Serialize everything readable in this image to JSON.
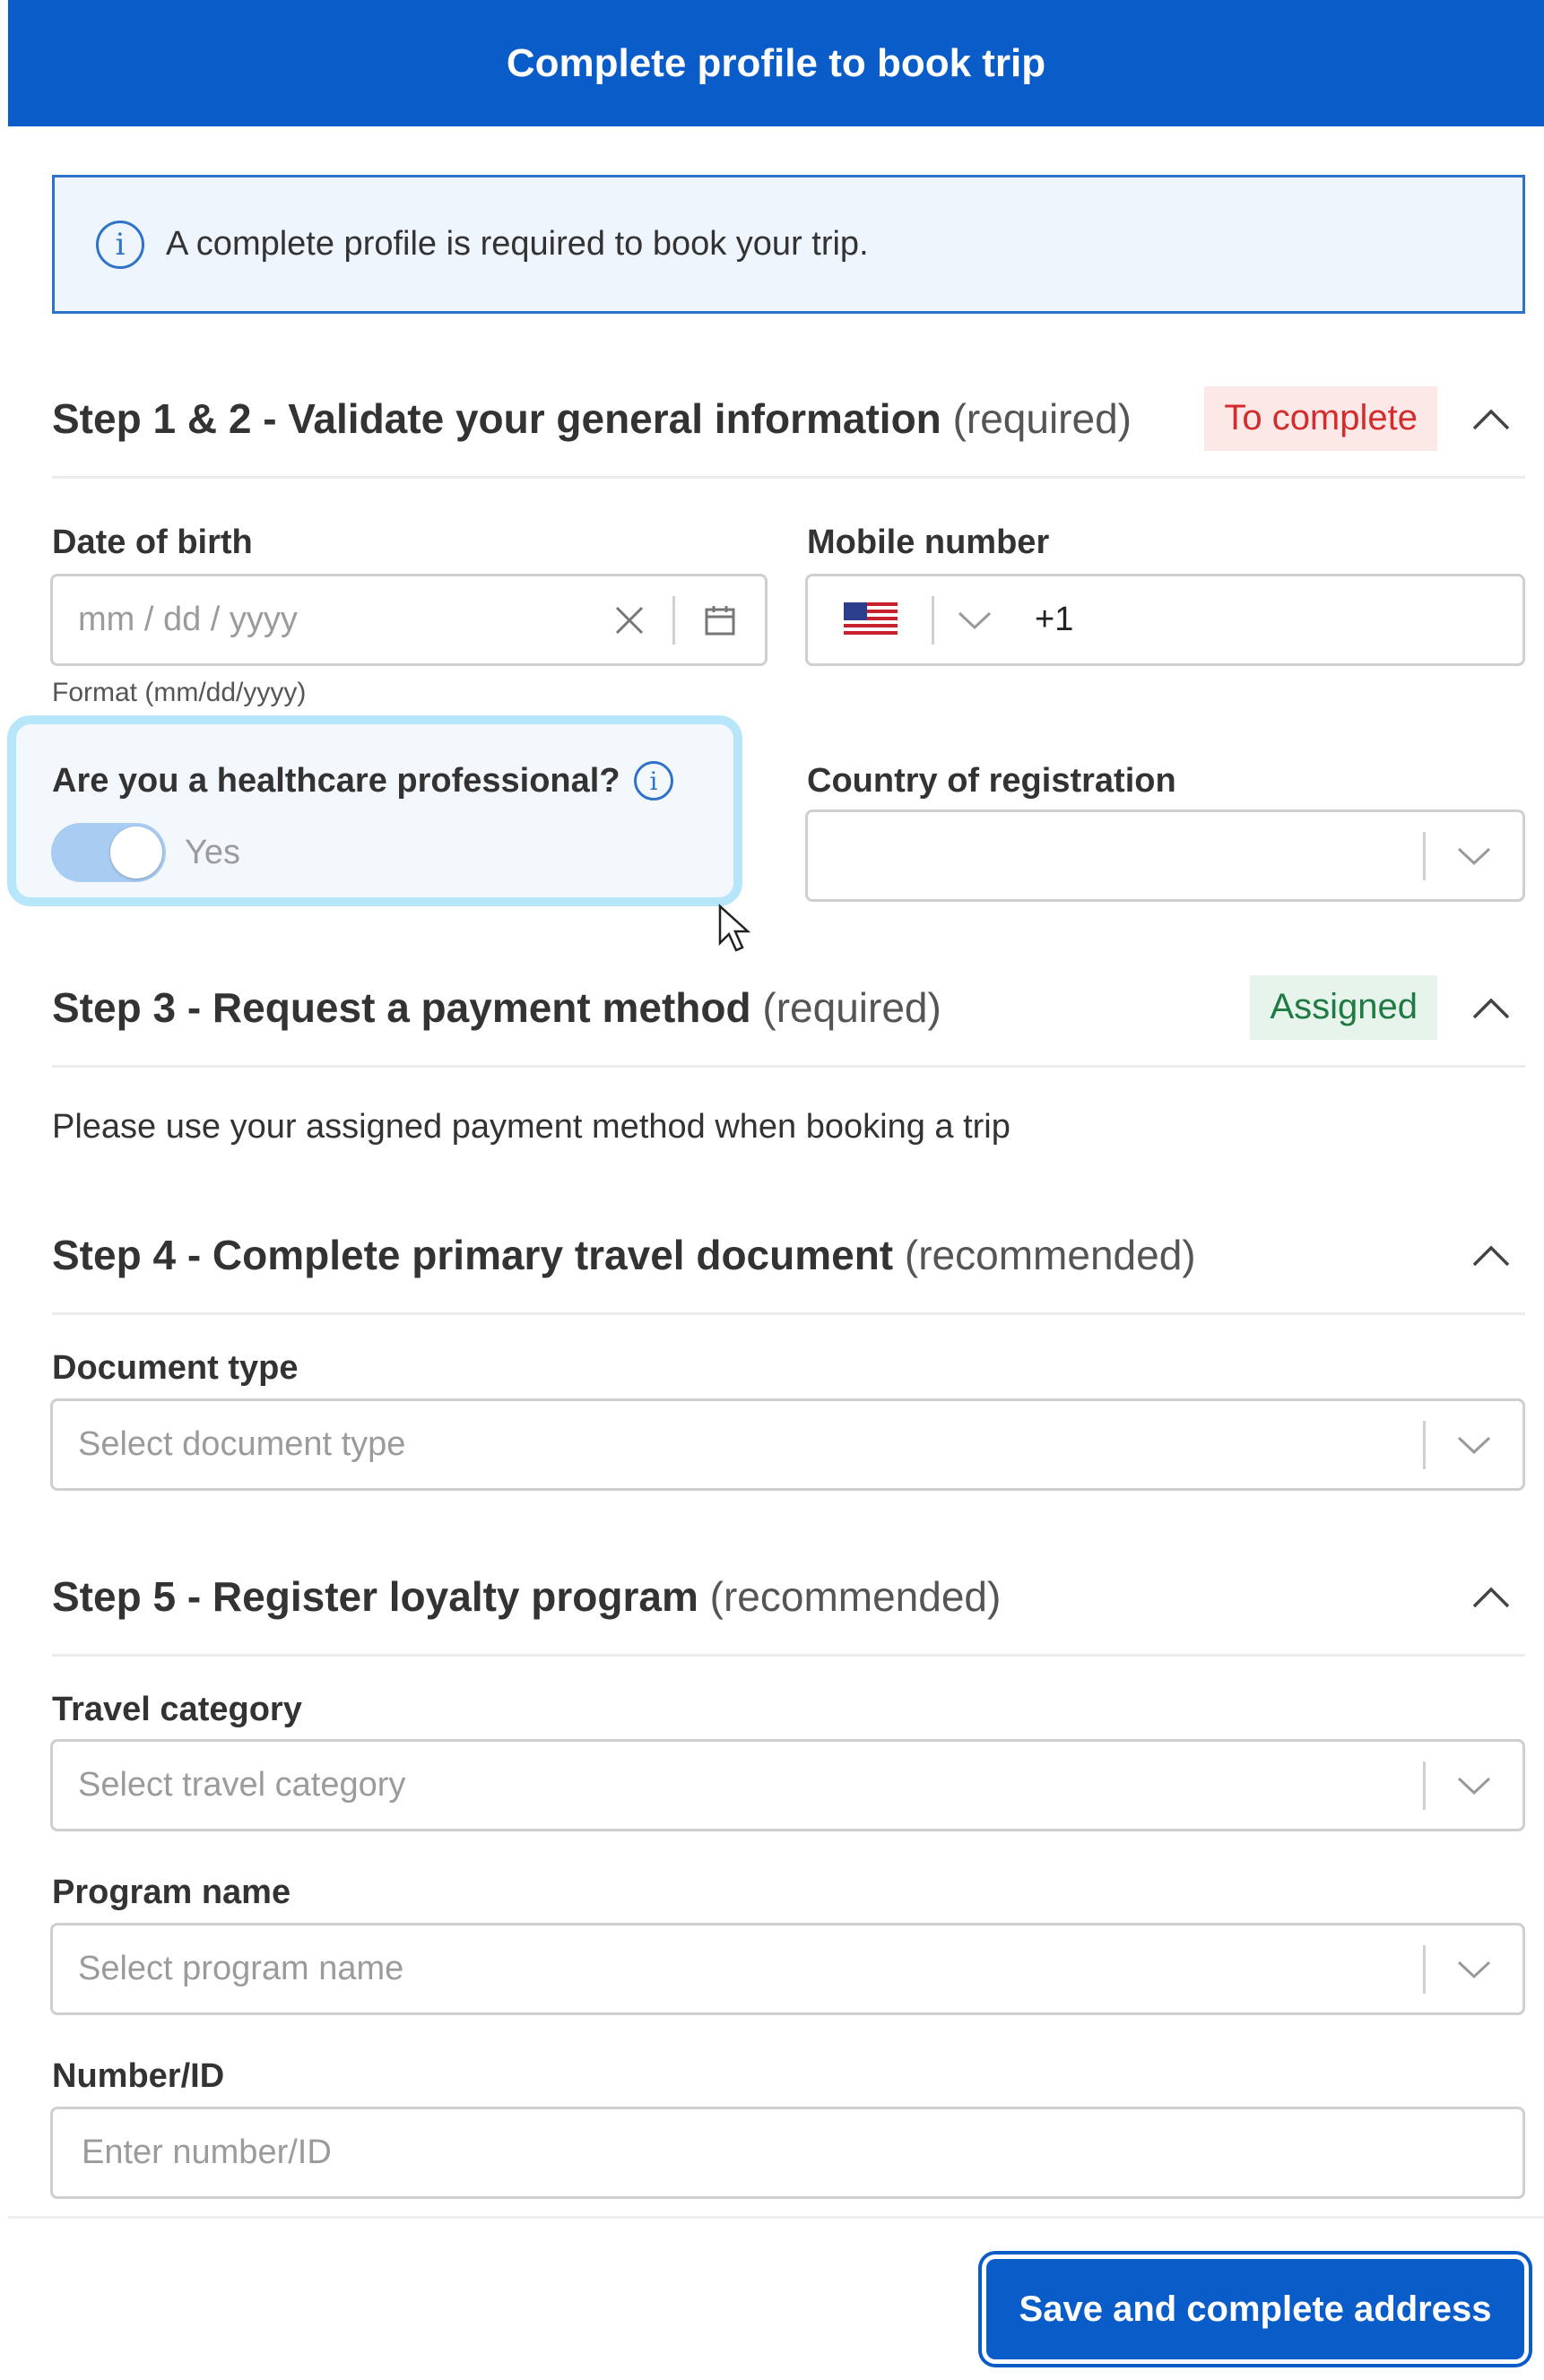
{
  "header": {
    "title": "Complete profile to book trip"
  },
  "notice": {
    "text": "A complete profile is required to book your trip."
  },
  "step12": {
    "title": "Step 1 & 2 - Validate your general information",
    "suffix": "(required)",
    "status": "To complete",
    "date_of_birth": {
      "label": "Date of birth",
      "placeholder": "mm / dd / yyyy",
      "hint": "Format (mm/dd/yyyy)"
    },
    "mobile": {
      "label": "Mobile number",
      "country_code": "+1"
    },
    "healthcare": {
      "label": "Are you a healthcare professional?",
      "toggle_label": "Yes"
    },
    "country": {
      "label": "Country of registration"
    }
  },
  "step3": {
    "title": "Step 3 - Request a payment method",
    "suffix": "(required)",
    "status": "Assigned",
    "body": "Please use your assigned payment method when booking a trip"
  },
  "step4": {
    "title": "Step 4 - Complete primary travel document",
    "suffix": "(recommended)",
    "document_type": {
      "label": "Document type",
      "placeholder": "Select document type"
    }
  },
  "step5": {
    "title": "Step 5 - Register loyalty program",
    "suffix": "(recommended)",
    "travel_category": {
      "label": "Travel category",
      "placeholder": "Select travel category"
    },
    "program_name": {
      "label": "Program name",
      "placeholder": "Select program name"
    },
    "number_id": {
      "label": "Number/ID",
      "placeholder": "Enter number/ID"
    }
  },
  "footer": {
    "save_label": "Save and complete address"
  },
  "colors": {
    "brand": "#0a5cc9",
    "status_red": "#d22c2c",
    "status_green": "#1f7a44"
  }
}
